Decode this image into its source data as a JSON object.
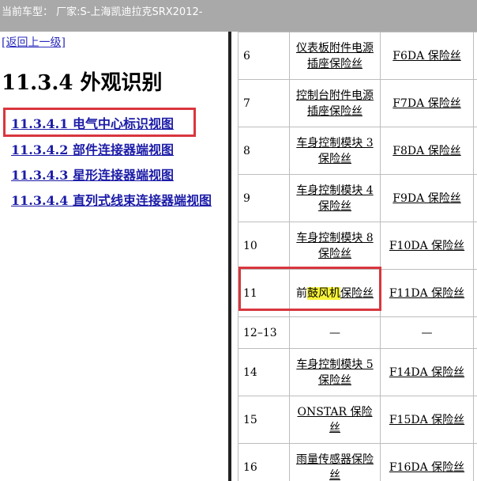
{
  "header": {
    "vehicle": "当前车型： 厂家:S-上海凯迪拉克SRX2012-"
  },
  "nav": {
    "back": "[返回上一级]",
    "title": "11.3.4 外观识别",
    "links": [
      "11.3.4.1 电气中心标识视图",
      "11.3.4.2 部件连接器端视图",
      "11.3.4.3 星形连接器端视图",
      "11.3.4.4 直列式线束连接器端视图"
    ]
  },
  "table": {
    "rows": [
      {
        "num": "6",
        "name": "仪表板附件电源插座保险丝",
        "fuse": "F6DA 保险丝"
      },
      {
        "num": "7",
        "name": "控制台附件电源插座保险丝",
        "fuse": "F7DA 保险丝"
      },
      {
        "num": "8",
        "name": "车身控制模块 3 保险丝",
        "fuse": "F8DA 保险丝"
      },
      {
        "num": "9",
        "name": "车身控制模块 4 保险丝",
        "fuse": "F9DA 保险丝"
      },
      {
        "num": "10",
        "name": "车身控制模块 8 保险丝",
        "fuse": "F10DA 保险丝"
      },
      {
        "num": "11",
        "name_pre": "前",
        "name_hl": "鼓风机",
        "name_post": "保险丝",
        "fuse": "F11DA 保险丝"
      },
      {
        "num": "12–13",
        "name": "—",
        "fuse": "—"
      },
      {
        "num": "14",
        "name": "车身控制模块 5 保险丝",
        "fuse": "F14DA 保险丝"
      },
      {
        "num": "15",
        "name": "ONSTAR 保险丝",
        "fuse": "F15DA 保险丝"
      },
      {
        "num": "16",
        "name": "雨量传感器保险丝",
        "fuse": "F16DA 保险丝"
      }
    ]
  },
  "colors": {
    "header_bg": "#a9a9a9",
    "highlight": "#f7f33a",
    "callout_border": "#d9363e",
    "link": "#1c1ca8"
  }
}
